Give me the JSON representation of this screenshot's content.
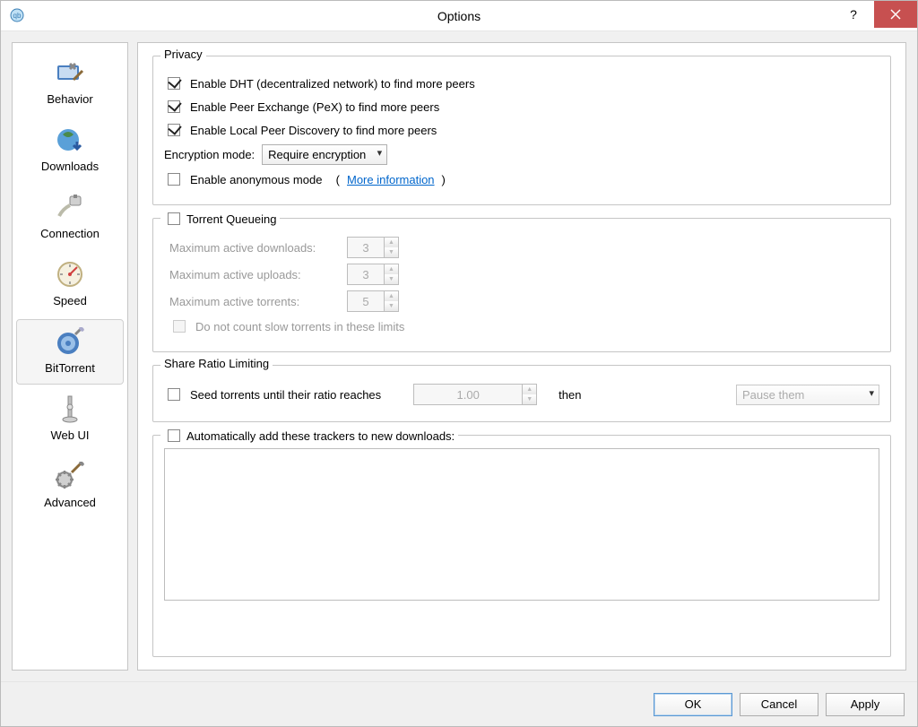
{
  "window": {
    "title": "Options"
  },
  "sidebar": {
    "items": [
      {
        "label": "Behavior"
      },
      {
        "label": "Downloads"
      },
      {
        "label": "Connection"
      },
      {
        "label": "Speed"
      },
      {
        "label": "BitTorrent"
      },
      {
        "label": "Web UI"
      },
      {
        "label": "Advanced"
      }
    ],
    "selected": "BitTorrent"
  },
  "privacy": {
    "legend": "Privacy",
    "dht": {
      "checked": true,
      "label": "Enable DHT (decentralized network) to find more peers"
    },
    "pex": {
      "checked": true,
      "label": "Enable Peer Exchange (PeX) to find more peers"
    },
    "lpd": {
      "checked": true,
      "label": "Enable Local Peer Discovery to find more peers"
    },
    "encryption_label": "Encryption mode:",
    "encryption_mode": "Require encryption",
    "anon": {
      "checked": false,
      "label": "Enable anonymous mode"
    },
    "more_info": "More information"
  },
  "queueing": {
    "legend": "Torrent Queueing",
    "enabled": false,
    "max_downloads_label": "Maximum active downloads:",
    "max_downloads": "3",
    "max_uploads_label": "Maximum active uploads:",
    "max_uploads": "3",
    "max_torrents_label": "Maximum active torrents:",
    "max_torrents": "5",
    "slow_label": "Do not count slow torrents in these limits",
    "slow_checked": false
  },
  "ratio": {
    "legend": "Share Ratio Limiting",
    "seed_until_label": "Seed torrents until their ratio reaches",
    "seed_until_checked": false,
    "ratio_value": "1.00",
    "then_label": "then",
    "action": "Pause them"
  },
  "trackers": {
    "auto_label": "Automatically add these trackers to new downloads:",
    "auto_checked": false,
    "text": ""
  },
  "footer": {
    "ok": "OK",
    "cancel": "Cancel",
    "apply": "Apply"
  }
}
